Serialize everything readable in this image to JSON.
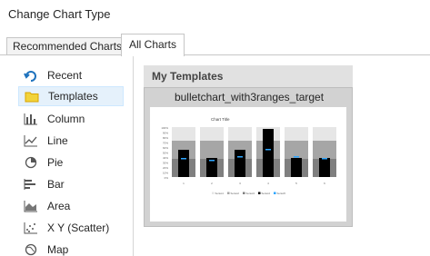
{
  "dialog": {
    "title": "Change Chart Type"
  },
  "tabs": [
    {
      "label": "Recommended Charts",
      "active": false
    },
    {
      "label": "All Charts",
      "active": true
    }
  ],
  "sidebar": {
    "items": [
      {
        "label": "Recent",
        "icon": "recent-icon"
      },
      {
        "label": "Templates",
        "icon": "templates-folder-icon",
        "selected": true
      },
      {
        "label": "Column",
        "icon": "column-chart-icon"
      },
      {
        "label": "Line",
        "icon": "line-chart-icon"
      },
      {
        "label": "Pie",
        "icon": "pie-chart-icon"
      },
      {
        "label": "Bar",
        "icon": "bar-chart-icon"
      },
      {
        "label": "Area",
        "icon": "area-chart-icon"
      },
      {
        "label": "X Y (Scatter)",
        "icon": "scatter-chart-icon"
      },
      {
        "label": "Map",
        "icon": "map-chart-icon"
      }
    ]
  },
  "templates": {
    "heading": "My Templates",
    "items": [
      {
        "name": "bulletchart_with3ranges_target",
        "preview": {
          "chart_title": "Chart Title",
          "y_ticks": [
            "100%",
            "90%",
            "80%",
            "70%",
            "60%",
            "50%",
            "40%",
            "30%",
            "20%",
            "10%",
            "0%"
          ],
          "categories": [
            "1",
            "2",
            "3",
            "4",
            "5",
            "6"
          ],
          "legend": [
            "Series1",
            "Series2",
            "Series3",
            "Series4",
            "Series5"
          ]
        }
      }
    ]
  },
  "colors": {
    "highlight": "#f2f23a",
    "accent": "#1e72bd",
    "target_marker": "#2ea6ff"
  }
}
